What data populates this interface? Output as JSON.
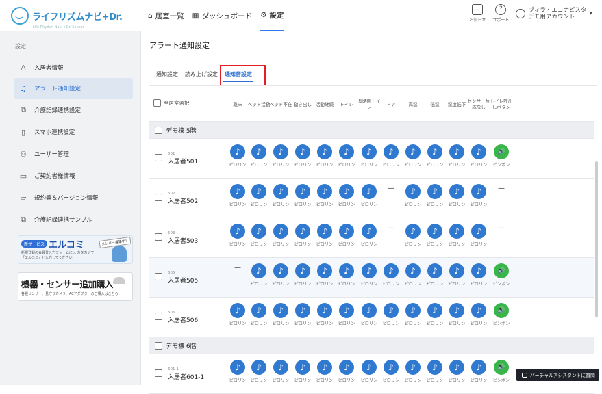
{
  "header": {
    "logo_text": "ライフリズムナビ+Dr.",
    "logo_sub": "Life Rhythm Navi +Dr. Sensor",
    "nav": [
      {
        "label": "居室一覧",
        "icon": "home-icon"
      },
      {
        "label": "ダッシュボード",
        "icon": "grid-icon"
      },
      {
        "label": "設定",
        "icon": "gear-icon"
      }
    ],
    "notice_label": "お知らせ",
    "support_label": "サポート",
    "account_line1": "ヴィラ・エコナビスタ",
    "account_line2": "デモ用アカウント"
  },
  "sidebar": {
    "title": "設定",
    "items": [
      {
        "label": "入居者情報",
        "icon": "person-icon"
      },
      {
        "label": "アラート通知設定",
        "icon": "bell-icon"
      },
      {
        "label": "介護記録連携設定",
        "icon": "link-icon"
      },
      {
        "label": "スマホ連携設定",
        "icon": "phone-icon"
      },
      {
        "label": "ユーザー管理",
        "icon": "users-icon"
      },
      {
        "label": "ご契約者様情報",
        "icon": "card-icon"
      },
      {
        "label": "規約等＆バージョン情報",
        "icon": "document-icon"
      },
      {
        "label": "介護記録連携サンプル",
        "icon": "link-icon"
      }
    ],
    "banner1": {
      "tag": "新サービス",
      "title": "エルコミ",
      "badge": "メンバー募集中！",
      "text": "新規登録の会員登入力フォームには カタカナで「エルコミ」と入力してください"
    },
    "banner2": {
      "title": "機器・センサー追加購入",
      "text": "各種センサー、見守りカメラ、ACアダプターのご購入はこちら"
    }
  },
  "main": {
    "title": "アラート通知設定",
    "tabs": [
      "通知設定",
      "読み上げ設定",
      "通知音設定"
    ],
    "active_tab": 2,
    "select_all": "全居室選択",
    "columns": [
      "離床",
      "ベッド活動",
      "ベッド不在",
      "動き出し",
      "活動継続",
      "トイレ",
      "長時間トイレ",
      "ドア",
      "高温",
      "低温",
      "湿度低下",
      "センサー反応なし",
      "トイレ呼出しボタン"
    ],
    "sound_a": "ピロリン",
    "sound_b": "ピンポン",
    "groups": [
      {
        "name": "デモ棟 5階",
        "rooms": [
          {
            "no": "501",
            "name": "入居者501",
            "cells": [
              "a",
              "a",
              "a",
              "a",
              "a",
              "a",
              "a",
              "a",
              "a",
              "a",
              "a",
              "a",
              "b"
            ]
          },
          {
            "no": "502",
            "name": "入居者502",
            "cells": [
              "a",
              "a",
              "a",
              "a",
              "a",
              "a",
              "a",
              "-",
              "a",
              "a",
              "a",
              "a",
              "-"
            ]
          },
          {
            "no": "503",
            "name": "入居者503",
            "cells": [
              "a",
              "a",
              "a",
              "a",
              "a",
              "a",
              "a",
              "-",
              "a",
              "a",
              "a",
              "a",
              "-"
            ]
          },
          {
            "no": "505",
            "name": "入居者505",
            "cells": [
              "-",
              "a",
              "a",
              "a",
              "a",
              "a",
              "a",
              "a",
              "a",
              "a",
              "a",
              "a",
              "b"
            ]
          },
          {
            "no": "506",
            "name": "入居者506",
            "cells": [
              "a",
              "a",
              "a",
              "a",
              "a",
              "a",
              "a",
              "a",
              "a",
              "a",
              "a",
              "a",
              "b"
            ]
          }
        ]
      },
      {
        "name": "デモ棟 6階",
        "rooms": [
          {
            "no": "601-1",
            "name": "入居者601-1",
            "cells": [
              "a",
              "a",
              "a",
              "a",
              "a",
              "a",
              "a",
              "a",
              "a",
              "a",
              "a",
              "a",
              "b"
            ]
          }
        ]
      }
    ]
  },
  "assistant_label": "バーチャルアシスタントに質問"
}
